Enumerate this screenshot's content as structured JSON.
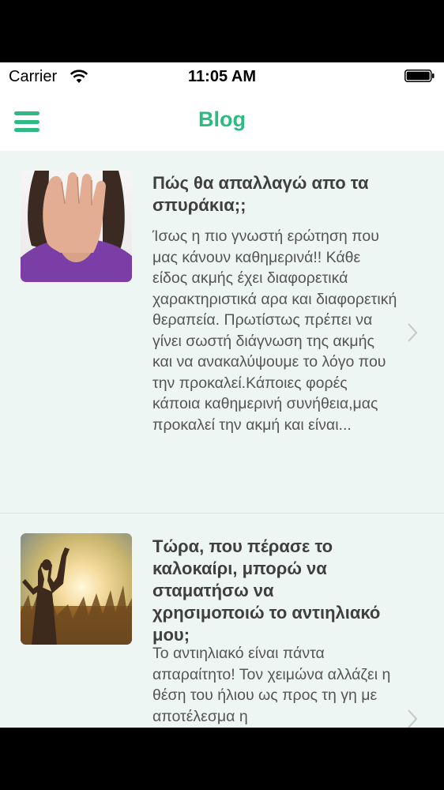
{
  "status_bar": {
    "carrier": "Carrier",
    "time": "11:05 AM",
    "wifi_icon": "wifi-icon",
    "battery_icon": "battery-full-icon"
  },
  "nav": {
    "title": "Blog",
    "menu_icon": "hamburger-menu-icon",
    "accent_color": "#2fb985"
  },
  "posts": [
    {
      "title": "Πώς θα απαλλαγώ απο τα σπυράκια;;",
      "excerpt": "Ίσως η πιο γνωστή ερώτηση που μας κάνουν καθημερινά!! Κάθε είδος ακμής έχει διαφορετικά χαρακτηριστικά αρα και διαφορετική θεραπεία. Πρωτίστως πρέπει να γίνει σωστή διάγνωση της ακμής και να ανακαλύψουμε το λόγο που την προκαλεί.Κάποιες φορές κάποια καθημερινή συνήθεια,μας προκαλεί την ακμή και είναι...",
      "thumbnail": "woman-covering-face-photo"
    },
    {
      "title": "Τώρα, που πέρασε το καλοκαίρι, μπορώ να σταματήσω να χρησιμοποιώ το αντιηλιακό μου;",
      "excerpt": "Το αντιηλιακό είναι πάντα απαραίτητο! Τον χειμώνα αλλάζει η θέση του ήλιου ως προς τη γη με αποτέλεσμα η",
      "thumbnail": "woman-in-sunset-field-photo"
    }
  ]
}
